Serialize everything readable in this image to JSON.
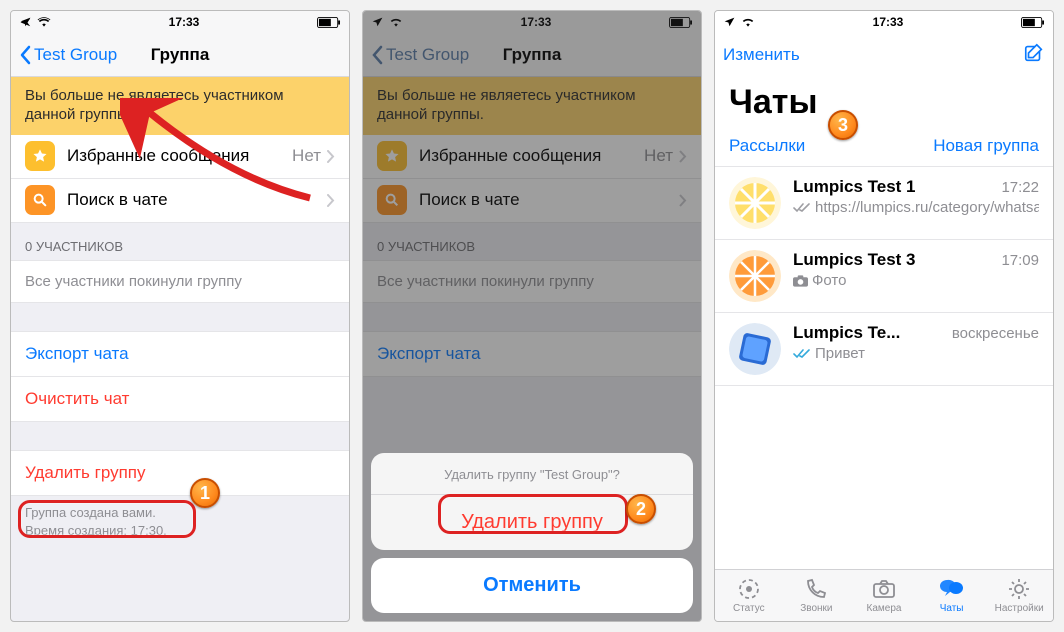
{
  "status": {
    "time": "17:33"
  },
  "p1": {
    "back_label": "Test Group",
    "title": "Группа",
    "banner": "Вы больше не являетесь участником данной группы.",
    "starred_label": "Избранные сообщения",
    "starred_value": "Нет",
    "search_label": "Поиск в чате",
    "participants_header": "0 УЧАСТНИКОВ",
    "participants_info": "Все участники покинули группу",
    "export_label": "Экспорт чата",
    "clear_label": "Очистить чат",
    "delete_label": "Удалить группу",
    "footer_line1": "Группа создана вами.",
    "footer_line2": "Время создания: 17:30."
  },
  "p2": {
    "back_label": "Test Group",
    "title": "Группа",
    "banner": "Вы больше не являетесь участником данной группы.",
    "starred_label": "Избранные сообщения",
    "starred_value": "Нет",
    "search_label": "Поиск в чате",
    "participants_header": "0 УЧАСТНИКОВ",
    "participants_info": "Все участники покинули группу",
    "export_label": "Экспорт чата",
    "sheet_title": "Удалить группу \"Test Group\"?",
    "sheet_delete": "Удалить группу",
    "sheet_cancel": "Отменить"
  },
  "p3": {
    "edit_label": "Изменить",
    "big_title": "Чаты",
    "sub_left": "Рассылки",
    "sub_right": "Новая группа",
    "chats": [
      {
        "name": "Lumpics Test 1",
        "time": "17:22",
        "msg": "https://lumpics.ru/category/whatsapp",
        "ticks": "gray"
      },
      {
        "name": "Lumpics Test 3",
        "time": "17:09",
        "msg": "Фото",
        "photo": true
      },
      {
        "name": "Lumpics Te...",
        "time": "воскресенье",
        "msg": "Привет",
        "ticks": "blue"
      }
    ],
    "tabs": {
      "status": "Статус",
      "calls": "Звонки",
      "camera": "Камера",
      "chats": "Чаты",
      "settings": "Настройки"
    }
  },
  "badges": {
    "1": "1",
    "2": "2",
    "3": "3"
  }
}
